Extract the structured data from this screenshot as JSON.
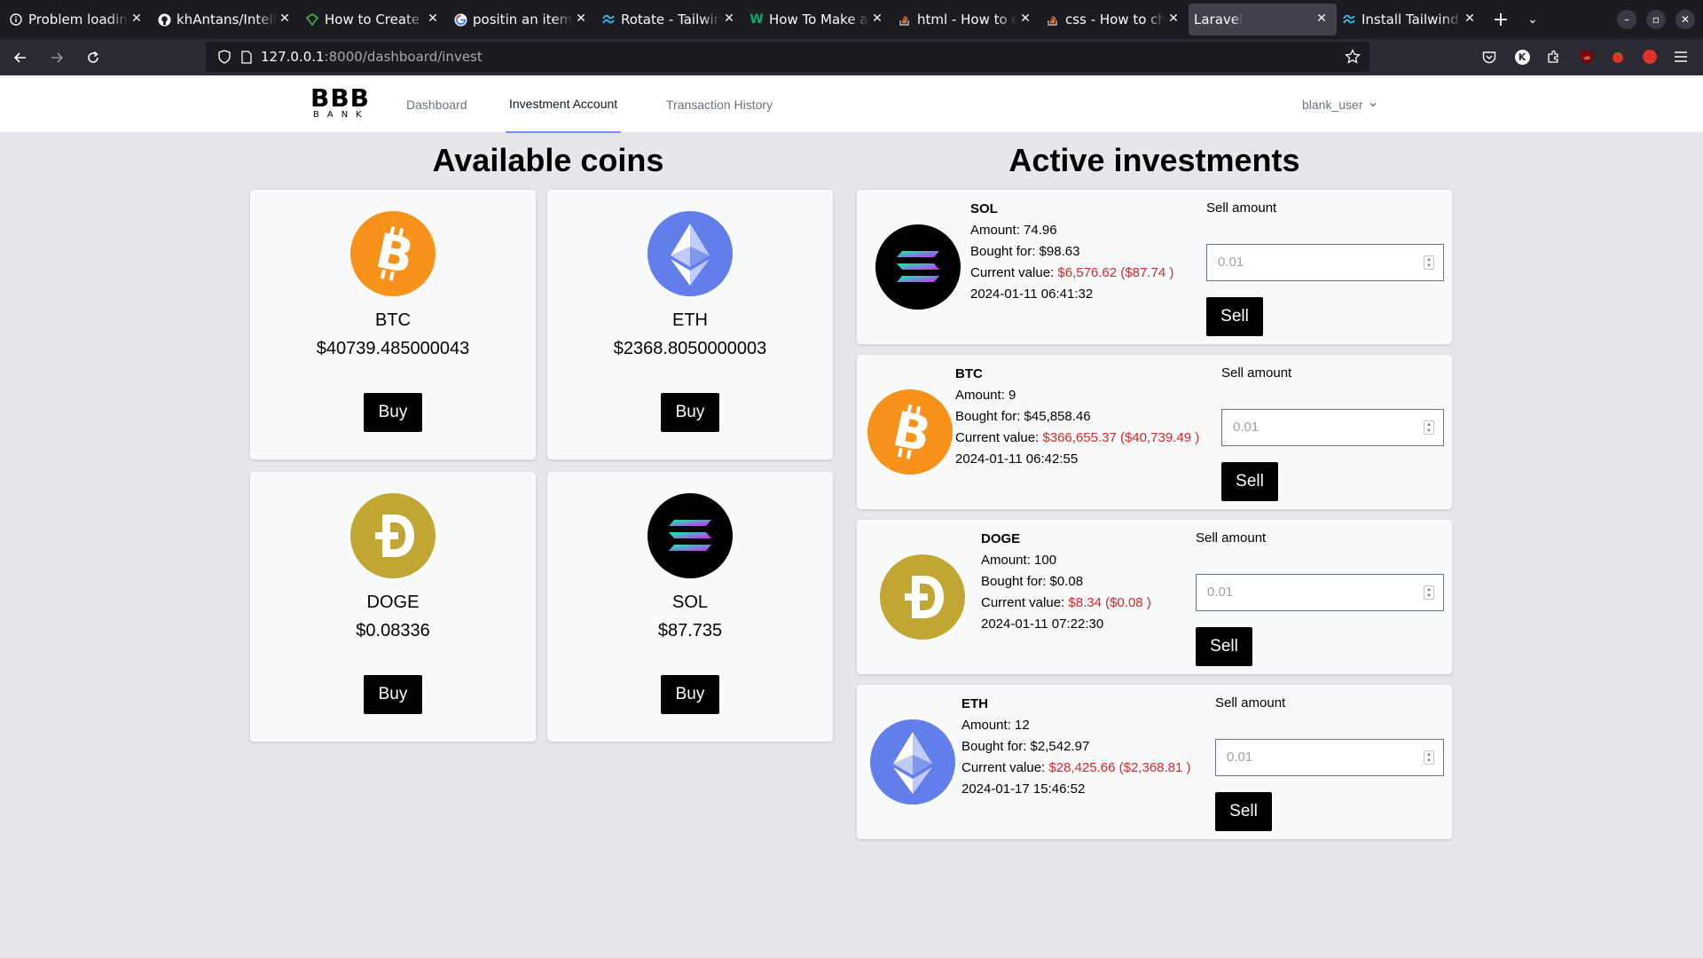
{
  "browser": {
    "tabs": [
      {
        "title": "Problem loading page",
        "icon": "info-icon"
      },
      {
        "title": "khAntans/IntelliBank",
        "icon": "github-icon"
      },
      {
        "title": "How to Create a",
        "icon": "site-icon"
      },
      {
        "title": "positin an item on",
        "icon": "google-icon"
      },
      {
        "title": "Rotate - Tailwind CSS",
        "icon": "tailwind-icon"
      },
      {
        "title": "How To Make a Modal",
        "icon": "w-icon"
      },
      {
        "title": "html - How to override",
        "icon": "stackoverflow-icon"
      },
      {
        "title": "css - How to change",
        "icon": "stackoverflow-icon"
      },
      {
        "title": "Laravel",
        "icon": "none"
      },
      {
        "title": "Install Tailwind CSS",
        "icon": "tailwind-icon"
      }
    ],
    "url_host": "127.0.0.1",
    "url_path": ":8000/dashboard/invest"
  },
  "app": {
    "logo_big": "BBB",
    "logo_small": "BANK",
    "nav": {
      "dashboard": "Dashboard",
      "investment": "Investment Account",
      "history": "Transaction History"
    },
    "user": "blank_user"
  },
  "available": {
    "title": "Available coins",
    "buy_label": "Buy",
    "coins": [
      {
        "symbol": "BTC",
        "price": "$40739.485000043"
      },
      {
        "symbol": "ETH",
        "price": "$2368.8050000003"
      },
      {
        "symbol": "DOGE",
        "price": "$0.08336"
      },
      {
        "symbol": "SOL",
        "price": "$87.735"
      }
    ]
  },
  "active": {
    "title": "Active investments",
    "sell_amount_label": "Sell amount",
    "sell_label": "Sell",
    "input_placeholder": "0.01",
    "items": [
      {
        "symbol": "SOL",
        "amount": "Amount: 74.96",
        "bought": "Bought for: $98.63",
        "current_prefix": "Current value: ",
        "current_value": "$6,576.62 ($87.74 )",
        "date": "2024-01-11 06:41:32"
      },
      {
        "symbol": "BTC",
        "amount": "Amount: 9",
        "bought": "Bought for: $45,858.46",
        "current_prefix": "Current value: ",
        "current_value": "$366,655.37 ($40,739.49 )",
        "date": "2024-01-11 06:42:55"
      },
      {
        "symbol": "DOGE",
        "amount": "Amount: 100",
        "bought": "Bought for: $0.08",
        "current_prefix": "Current value: ",
        "current_value": "$8.34 ($0.08 )",
        "date": "2024-01-11 07:22:30"
      },
      {
        "symbol": "ETH",
        "amount": "Amount: 12",
        "bought": "Bought for: $2,542.97",
        "current_prefix": "Current value: ",
        "current_value": "$28,425.66 ($2,368.81 )",
        "date": "2024-01-17 15:46:52"
      }
    ]
  },
  "colors": {
    "btc": "#f7931a",
    "eth": "#627eea",
    "doge": "#c2a633",
    "sol": "#000000",
    "loss_red": "#dc2626",
    "nav_active_underline": "#818cf8"
  }
}
